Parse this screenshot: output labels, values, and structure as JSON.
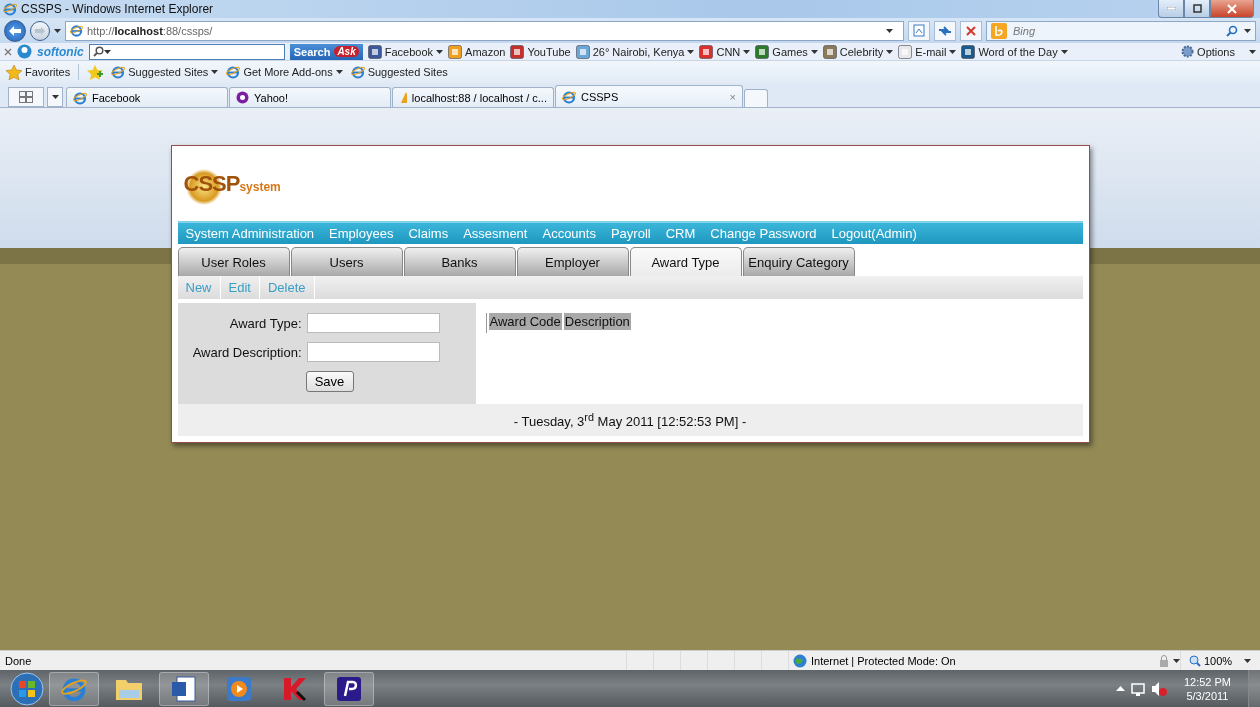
{
  "window": {
    "title": "CSSPS - Windows Internet Explorer"
  },
  "address_bar": {
    "url": "http://**localhost**:88/cssps/",
    "search_placeholder": "Bing"
  },
  "toolbar": {
    "brand": "softonic",
    "search_button": "Search",
    "search_badge": "Ask",
    "items": [
      {
        "label": "Facebook",
        "dropdown": true
      },
      {
        "label": "Amazon",
        "dropdown": false
      },
      {
        "label": "YouTube",
        "dropdown": false
      },
      {
        "label": "26° Nairobi, Kenya",
        "dropdown": true
      },
      {
        "label": "CNN",
        "dropdown": true
      },
      {
        "label": "Games",
        "dropdown": true
      },
      {
        "label": "Celebrity",
        "dropdown": true
      },
      {
        "label": "E-mail",
        "dropdown": true
      },
      {
        "label": "Word of the Day",
        "dropdown": true
      }
    ],
    "options": "Options"
  },
  "favorites_bar": {
    "favorites": "Favorites",
    "items": [
      {
        "label": "Suggested Sites",
        "dropdown": true
      },
      {
        "label": "Get More Add-ons",
        "dropdown": true
      },
      {
        "label": "Suggested Sites",
        "dropdown": false
      }
    ]
  },
  "browser_tabs": [
    {
      "label": "Facebook",
      "selected": false
    },
    {
      "label": "Yahoo!",
      "selected": false
    },
    {
      "label": "localhost:88 / localhost / c...",
      "selected": false
    },
    {
      "label": "CSSPS",
      "selected": true,
      "close": "×"
    }
  ],
  "page": {
    "logo": {
      "main": "CSSP",
      "sub": "system"
    },
    "menu": [
      "System Administration",
      "Employees",
      "Claims",
      "Assesment",
      "Accounts",
      "Payroll",
      "CRM",
      "Change Password",
      "Logout(Admin)"
    ],
    "tabs": [
      {
        "label": "User Roles",
        "selected": false
      },
      {
        "label": "Users",
        "selected": false
      },
      {
        "label": "Banks",
        "selected": false
      },
      {
        "label": "Employer",
        "selected": false
      },
      {
        "label": "Award Type",
        "selected": true
      },
      {
        "label": "Enquiry Category",
        "selected": false
      }
    ],
    "actions": [
      "New",
      "Edit",
      "Delete"
    ],
    "form": {
      "fields": [
        "Award Type:",
        "Award Description:"
      ],
      "button": "Save"
    },
    "table": {
      "columns": [
        "Award Code",
        "Description"
      ]
    },
    "footer": "- Tuesday, 3$^{rd}$ May 2011 [12:52:53 PM] -"
  },
  "status_bar": {
    "text": "Done",
    "zone": "Internet | Protected Mode: On",
    "zoom": "100%"
  },
  "taskbar": {
    "time": "12:52 PM",
    "date": "5/3/2011"
  }
}
